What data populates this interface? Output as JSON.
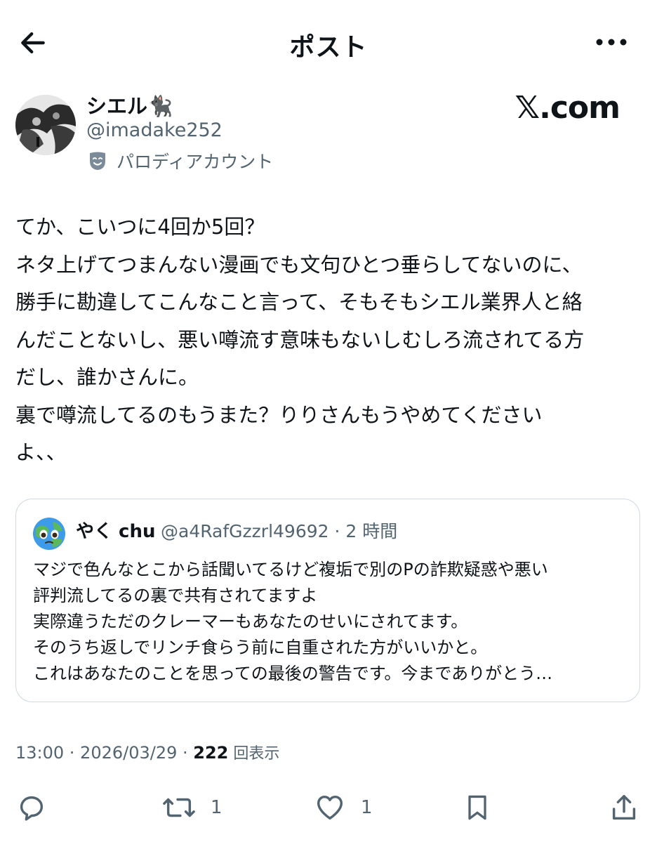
{
  "header": {
    "title": "ポスト",
    "back_icon": "arrow-left-icon",
    "more_icon": "more-horizontal-icon"
  },
  "author": {
    "display_name": "シエル🐈‍⬛",
    "handle": "@imadake252",
    "parody_label": "パロディアカウント",
    "parody_icon": "theater-mask-icon"
  },
  "brand": {
    "logo_text": "𝕏.com"
  },
  "post": {
    "lines": [
      "てか、こいつに4回か5回？",
      "ネタ上げてつまんない漫画でも文句ひとつ垂らしてないのに、",
      "勝手に勘違してこんなこと言って、そもそもシエル業界人と絡",
      "んだことないし、悪い噂流す意味もないしむしろ流されてる方",
      "だし、誰かさんに。",
      "裏で噂流してるのもうまた？りりさんもうやめてください",
      "よ、、"
    ]
  },
  "quote": {
    "avatar_icon": "earth-face-icon",
    "name": "やく chu",
    "handle_time": "@a4RafGzzrl49692 · 2 時間",
    "lines": [
      "マジで色んなとこから話聞いてるけど複垢で別のPの詐欺疑惑や悪い",
      "評判流してるの裏で共有されてますよ",
      "実際違うただのクレーマーもあなたのせいにされてます。",
      "そのうち返しでリンチ食らう前に自重された方がいいかと。",
      "これはあなたのことを思っての最後の警告です。今までありがとう…"
    ]
  },
  "meta": {
    "time_date": "13:00 · 2026/03/29 · ",
    "views_count": "222",
    "views_label": " 回表示"
  },
  "actions": {
    "reply_icon": "reply-icon",
    "repost_icon": "repost-icon",
    "repost_count": "1",
    "like_icon": "heart-icon",
    "like_count": "1",
    "bookmark_icon": "bookmark-icon",
    "share_icon": "share-icon"
  },
  "colors": {
    "text": "#0f1419",
    "secondary": "#536471",
    "border": "#cfd9de"
  }
}
